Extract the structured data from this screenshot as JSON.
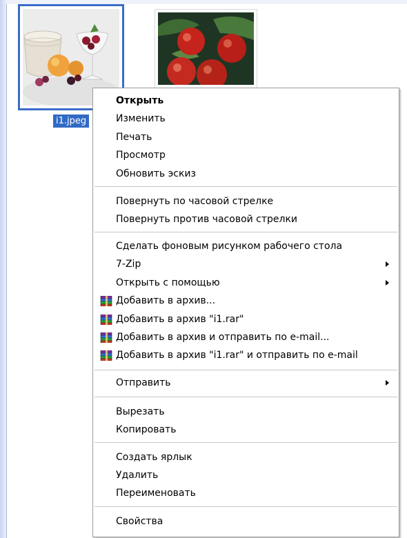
{
  "files": [
    {
      "name": "i1.jpeg",
      "selected": true
    },
    {
      "name": "",
      "selected": false
    }
  ],
  "menu": {
    "items": [
      {
        "label": "Открыть"
      },
      {
        "label": "Изменить"
      },
      {
        "label": "Печать"
      },
      {
        "label": "Просмотр"
      },
      {
        "label": "Обновить эскиз"
      },
      {
        "label": "Повернуть по часовой стрелке"
      },
      {
        "label": "Повернуть против часовой стрелки"
      },
      {
        "label": "Сделать фоновым рисунком рабочего стола"
      },
      {
        "label": "7-Zip"
      },
      {
        "label": "Открыть с помощью"
      },
      {
        "label": "Добавить в архив..."
      },
      {
        "label": "Добавить в архив \"i1.rar\""
      },
      {
        "label": "Добавить в архив и отправить по e-mail..."
      },
      {
        "label": "Добавить в архив \"i1.rar\" и отправить по e-mail"
      },
      {
        "label": "Отправить"
      },
      {
        "label": "Вырезать"
      },
      {
        "label": "Копировать"
      },
      {
        "label": "Создать ярлык"
      },
      {
        "label": "Удалить"
      },
      {
        "label": "Переименовать"
      },
      {
        "label": "Свойства"
      }
    ]
  },
  "icons": {
    "submenu": "chevron-right-icon",
    "archive": "winrar-books-icon"
  },
  "colors": {
    "selection": "#316ac5",
    "thumbnail_border": "#3a6bc7"
  }
}
